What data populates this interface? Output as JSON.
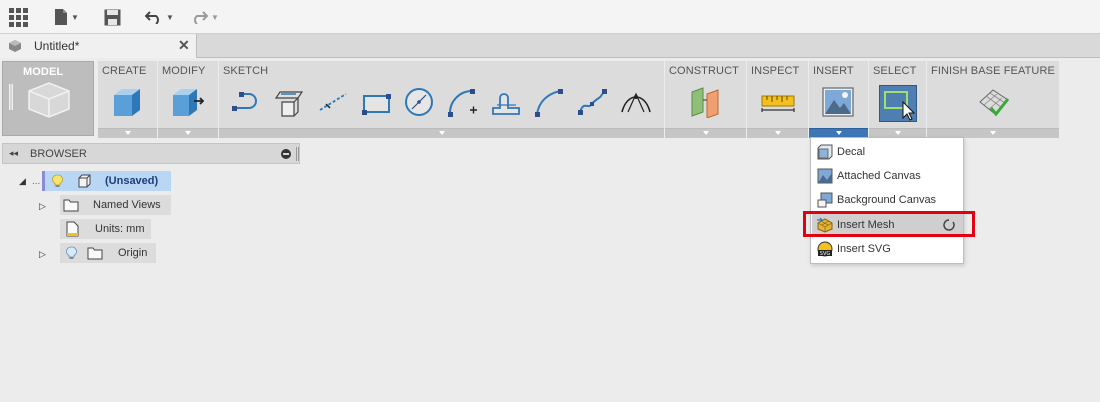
{
  "document": {
    "tab_title": "Untitled*"
  },
  "ribbon": {
    "groups": {
      "model": "MODEL",
      "create": "CREATE",
      "modify": "MODIFY",
      "sketch": "SKETCH",
      "construct": "CONSTRUCT",
      "inspect": "INSPECT",
      "insert": "INSERT",
      "select": "SELECT",
      "finish": "FINISH BASE FEATURE"
    }
  },
  "browser": {
    "title": "BROWSER",
    "root_label": "(Unsaved)",
    "root_prefix": "...",
    "items": {
      "named_views": "Named Views",
      "units": "Units: mm",
      "origin": "Origin"
    }
  },
  "insert_menu": {
    "items": [
      "Decal",
      "Attached Canvas",
      "Background Canvas",
      "Insert Mesh",
      "Insert SVG"
    ]
  },
  "colors": {
    "highlight": "#e3000f",
    "selection_blue": "#b9d6f5",
    "active_group": "#4f7fb0"
  }
}
